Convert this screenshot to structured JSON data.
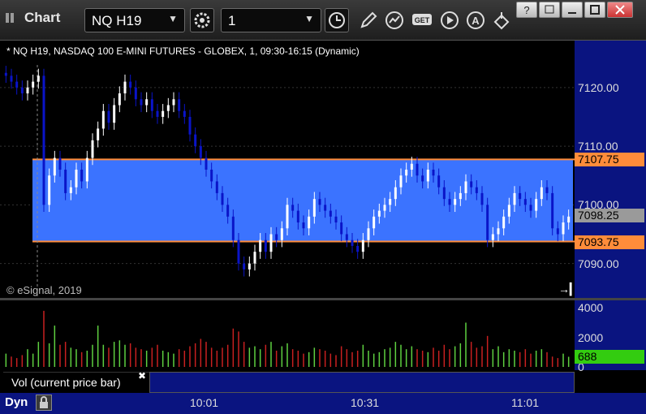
{
  "window": {
    "title": "Chart",
    "symbol_value": "NQ H19",
    "interval_value": "1"
  },
  "chart": {
    "header": "* NQ H19, NASDAQ 100 E-MINI FUTURES - GLOBEX, 1, 09:30-16:15 (Dynamic)",
    "copyright": "© eSignal, 2019",
    "price_labels": [
      "7120.00",
      "7110.00",
      "7100.00",
      "7090.00"
    ],
    "upper_line": "7107.75",
    "last_price": "7098.25",
    "lower_line": "7093.75",
    "colors": {
      "band": "#3b73ff",
      "line": "#ff8c3a",
      "up": "#ffffff",
      "down": "#0a14c8",
      "vol_up": "#5ed040",
      "vol_down": "#c82020",
      "axis": "#0a1480"
    }
  },
  "volume": {
    "legend": "Vol (current price bar)",
    "labels": [
      "4000",
      "2000",
      "0"
    ],
    "current": "688"
  },
  "time_axis": {
    "mode": "Dyn",
    "labels": [
      "10:01",
      "10:31",
      "11:01"
    ]
  },
  "chart_data": {
    "type": "candlestick",
    "ylim": [
      7084,
      7128
    ],
    "upper": 7107.75,
    "lower": 7093.75,
    "last": 7098.25,
    "closes": [
      7122,
      7121,
      7120,
      7119,
      7120,
      7121,
      7122,
      7100,
      7105,
      7108,
      7106,
      7102,
      7103,
      7106,
      7104,
      7108,
      7111,
      7113,
      7116,
      7114,
      7117,
      7119,
      7121,
      7120,
      7118,
      7117,
      7118,
      7116,
      7115,
      7116,
      7117,
      7118,
      7116,
      7115,
      7112,
      7110,
      7108,
      7106,
      7104,
      7102,
      7100,
      7098,
      7094,
      7090,
      7089,
      7090,
      7092,
      7094,
      7092,
      7095,
      7094,
      7096,
      7100,
      7099,
      7097,
      7096,
      7098,
      7101,
      7100,
      7099,
      7098,
      7097,
      7095,
      7094,
      7093,
      7092,
      7094,
      7096,
      7098,
      7099,
      7100,
      7101,
      7103,
      7105,
      7106,
      7107,
      7105,
      7104,
      7106,
      7105,
      7103,
      7101,
      7100,
      7101,
      7102,
      7104,
      7103,
      7102,
      7100,
      7094,
      7095,
      7096,
      7098,
      7100,
      7102,
      7101,
      7100,
      7099,
      7101,
      7103,
      7102,
      7096,
      7095,
      7097,
      7098
    ],
    "volumes": [
      900,
      700,
      600,
      800,
      1200,
      900,
      1700,
      3800,
      1600,
      2800,
      1500,
      1700,
      1300,
      1200,
      1000,
      1100,
      1500,
      2800,
      1500,
      1300,
      1700,
      1800,
      1500,
      1600,
      1300,
      1200,
      1100,
      1300,
      1500,
      1100,
      1000,
      900,
      1200,
      1100,
      1400,
      1600,
      1900,
      1700,
      1300,
      1100,
      1300,
      1500,
      2600,
      2400,
      1700,
      1300,
      1400,
      1200,
      1500,
      1700,
      1100,
      1400,
      1600,
      1200,
      1100,
      900,
      1000,
      1300,
      1200,
      1100,
      900,
      800,
      1400,
      1200,
      1000,
      1100,
      1500,
      1100,
      900,
      1000,
      1200,
      1300,
      1700,
      1500,
      1200,
      1400,
      1200,
      1100,
      1000,
      1300,
      1100,
      1500,
      1200,
      1400,
      1600,
      3000,
      1700,
      1300,
      1400,
      2100,
      1200,
      1400,
      1000,
      1200,
      1100,
      1000,
      1200,
      900,
      1100,
      1200,
      1000,
      700,
      600,
      900,
      688
    ]
  }
}
